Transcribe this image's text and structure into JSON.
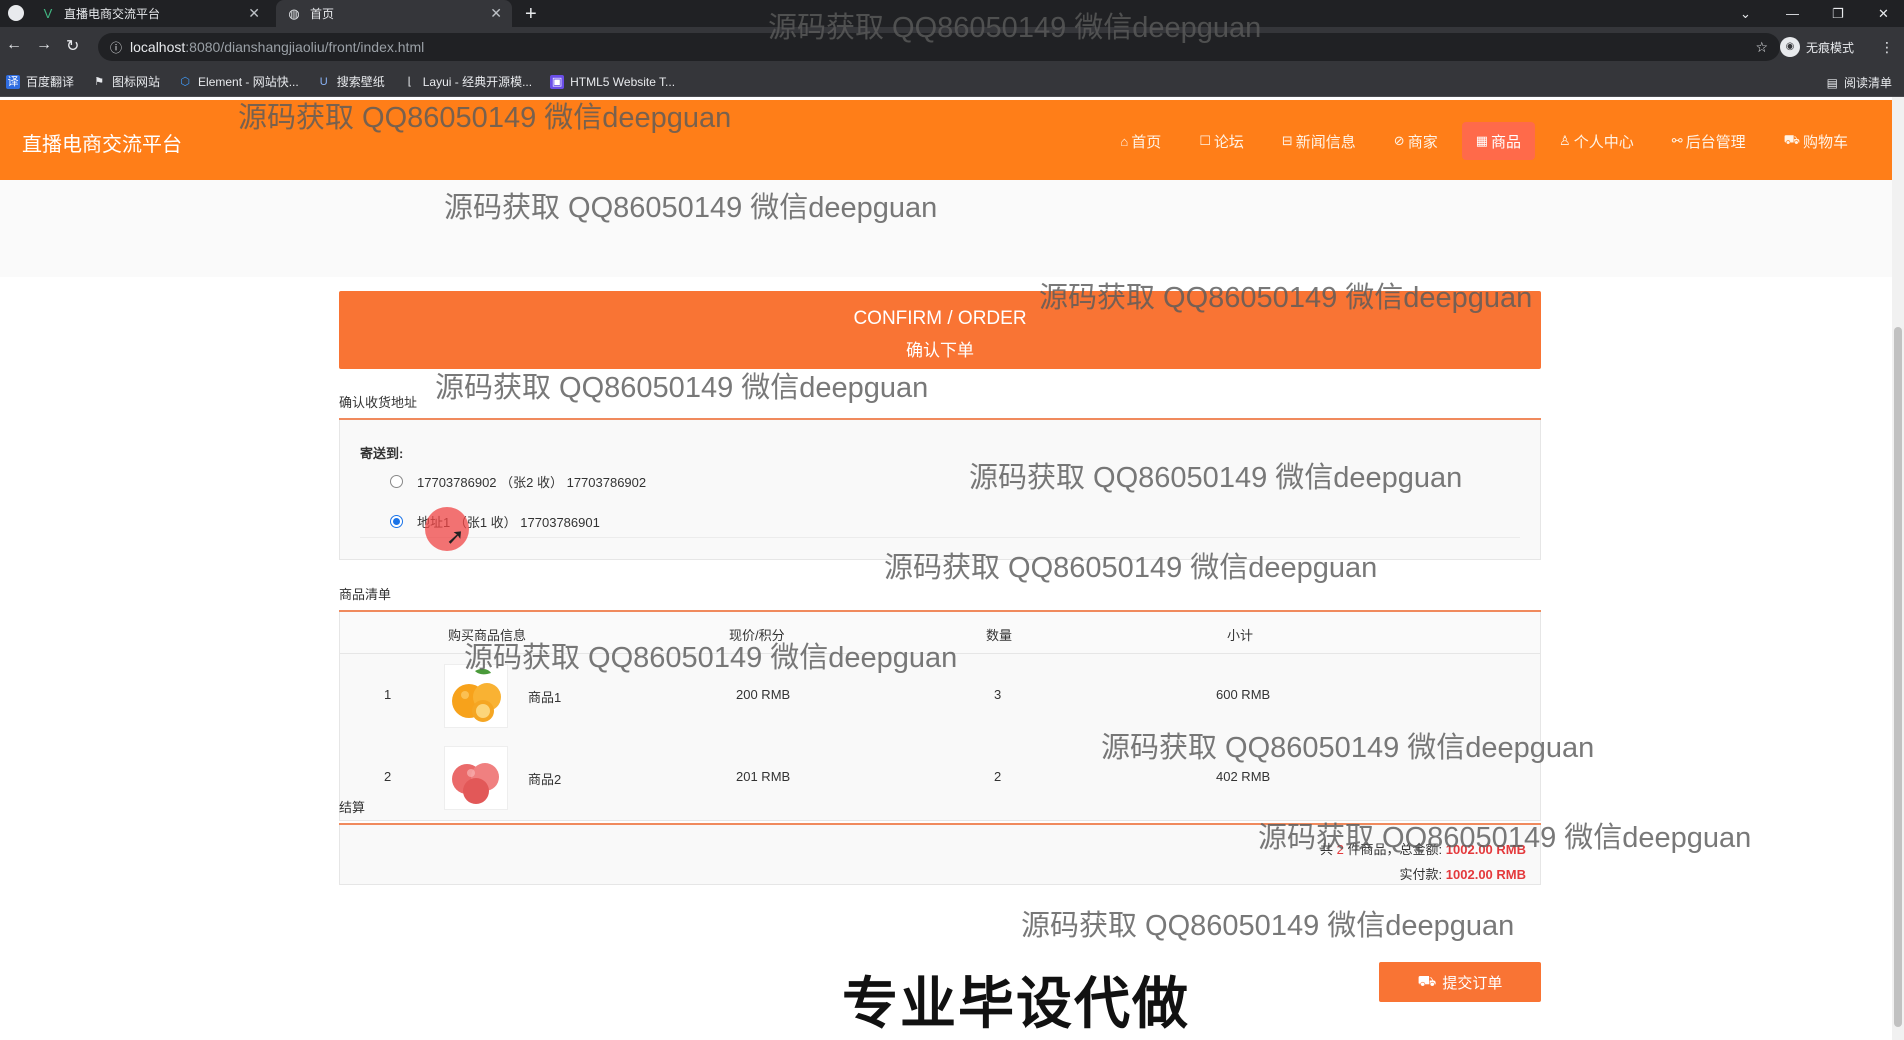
{
  "browser": {
    "tabs": [
      {
        "title": "直播电商交流平台",
        "icon": "vue-logo-icon"
      },
      {
        "title": "首页",
        "icon": "globe-icon"
      }
    ],
    "new_tab": "+",
    "url_host": "localhost",
    "url_path": ":8080/dianshangjiaoliu/front/index.html",
    "profile_label": "无痕模式",
    "bookmarks": [
      "百度翻译",
      "图标网站",
      "Element - 网站快...",
      "搜索壁纸",
      "Layui - 经典开源模...",
      "HTML5 Website T..."
    ],
    "reading_list": "阅读清单"
  },
  "site": {
    "title": "直播电商交流平台",
    "nav": [
      {
        "label": "首页",
        "icon": "home-icon"
      },
      {
        "label": "论坛",
        "icon": "chat-icon"
      },
      {
        "label": "新闻信息",
        "icon": "news-icon"
      },
      {
        "label": "商家",
        "icon": "shop-icon"
      },
      {
        "label": "商品",
        "icon": "goods-icon",
        "active": true
      },
      {
        "label": "个人中心",
        "icon": "user-icon"
      },
      {
        "label": "后台管理",
        "icon": "link-icon"
      },
      {
        "label": "购物车",
        "icon": "cart-icon"
      }
    ]
  },
  "order": {
    "banner_en": "CONFIRM / ORDER",
    "banner_zh": "确认下单",
    "address_section": "确认收货地址",
    "ship_to": "寄送到:",
    "addresses": [
      {
        "text": "17703786902 （张2 收） 17703786902",
        "selected": false
      },
      {
        "text": "地址1 （张1 收） 17703786901",
        "selected": true
      }
    ],
    "goods_section": "商品清单",
    "columns": [
      "购买商品信息",
      "现价/积分",
      "数量",
      "小计"
    ],
    "items": [
      {
        "index": "1",
        "name": "商品1",
        "price": "200 RMB",
        "qty": "3",
        "subtotal": "600 RMB",
        "image": "orange-fruit-icon"
      },
      {
        "index": "2",
        "name": "商品2",
        "price": "201 RMB",
        "qty": "2",
        "subtotal": "402 RMB",
        "image": "apple-fruit-icon"
      }
    ],
    "settle_section": "结算",
    "summary_prefix": "共",
    "count": "2",
    "summary_mid": "件商品，总金额:",
    "total": "1002.00 RMB",
    "actual_label": "实付款:",
    "actual_total": "1002.00 RMB",
    "submit": "提交订单"
  },
  "overlay": {
    "watermark": "源码获取 QQ86050149 微信deepguan",
    "ad_text": "专业毕设代做"
  },
  "colors": {
    "header": "#ff7e18",
    "accent": "#f97434",
    "price_red": "#e4393c"
  }
}
